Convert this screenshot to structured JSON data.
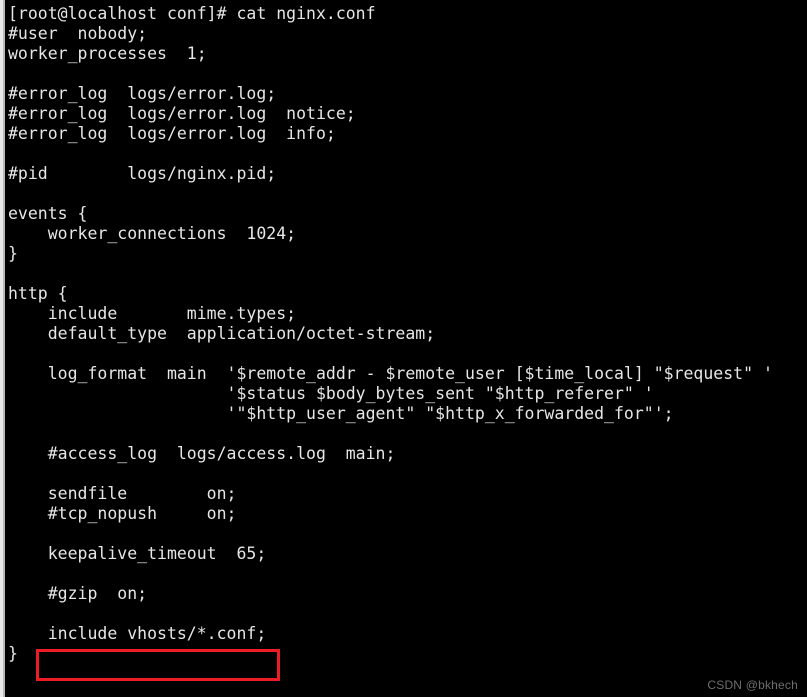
{
  "window": {
    "title": "Terminal",
    "background_color": "#000000",
    "text_color": "#e6e6e6",
    "left_edge_color": "#e9e9ea"
  },
  "terminal": {
    "prompt": "[root@localhost conf]#",
    "command": "cat nginx.conf",
    "prompt_line": "[root@localhost conf]# cat nginx.conf",
    "lines": [
      "[root@localhost conf]# cat nginx.conf",
      "#user  nobody;",
      "worker_processes  1;",
      "",
      "#error_log  logs/error.log;",
      "#error_log  logs/error.log  notice;",
      "#error_log  logs/error.log  info;",
      "",
      "#pid        logs/nginx.pid;",
      "",
      "events {",
      "    worker_connections  1024;",
      "}",
      "",
      "http {",
      "    include       mime.types;",
      "    default_type  application/octet-stream;",
      "",
      "    log_format  main  '$remote_addr - $remote_user [$time_local] \"$request\" '",
      "                      '$status $body_bytes_sent \"$http_referer\" '",
      "                      '\"$http_user_agent\" \"$http_x_forwarded_for\"';",
      "",
      "    #access_log  logs/access.log  main;",
      "",
      "    sendfile        on;",
      "    #tcp_nopush     on;",
      "",
      "    keepalive_timeout  65;",
      "",
      "    #gzip  on;",
      "",
      "    include vhosts/*.conf;",
      "}"
    ]
  },
  "annotation": {
    "highlight_box_color": "#ec1c24",
    "highlighted_text": "include vhosts/*.conf;"
  },
  "watermark": {
    "text": "CSDN @bkhech",
    "color": "#6e6e6e"
  }
}
